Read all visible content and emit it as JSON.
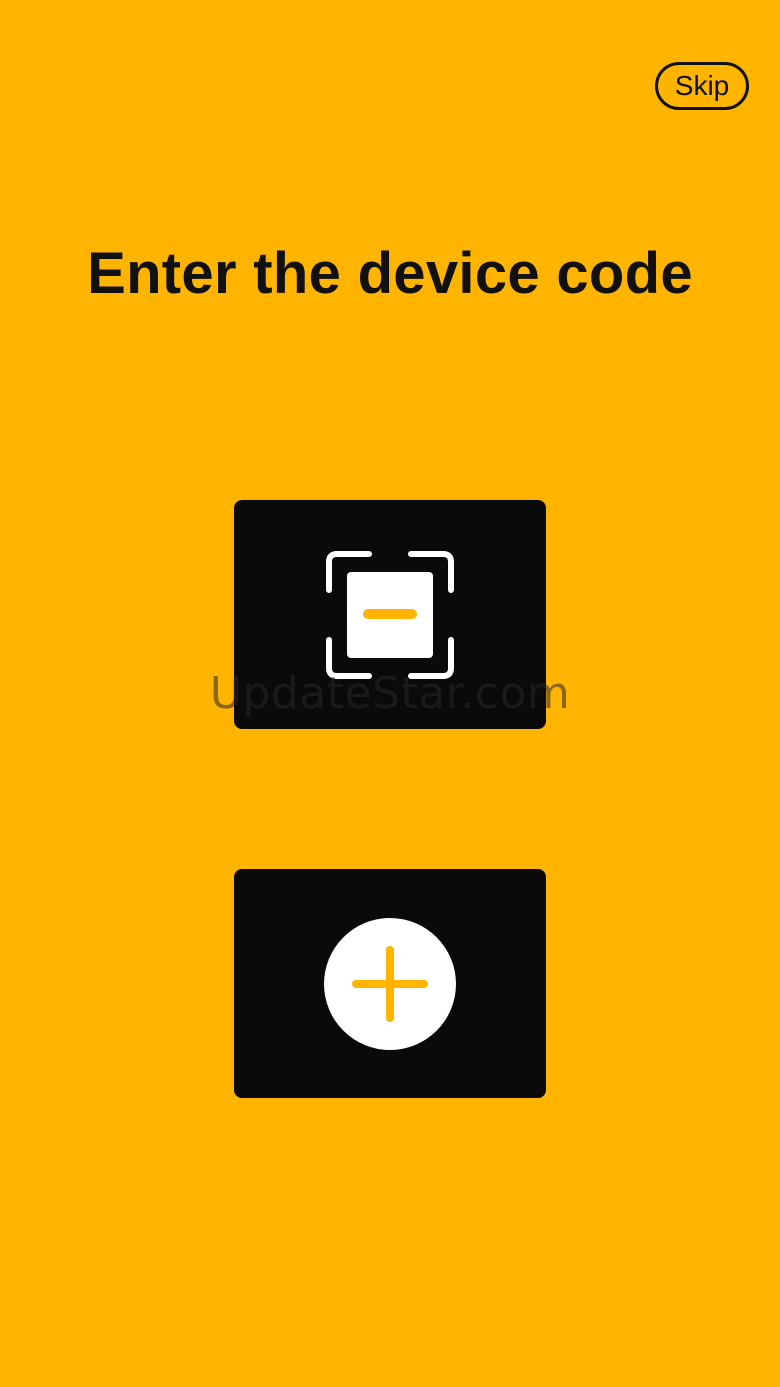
{
  "header": {
    "skip_label": "Skip"
  },
  "main": {
    "title": "Enter the device code",
    "actions": [
      {
        "icon": "scan-frame-icon"
      },
      {
        "icon": "plus-circle-icon"
      }
    ]
  },
  "watermark": "UpdateStar.com",
  "colors": {
    "background": "#FFB400",
    "card": "#0A0A0A",
    "icon_light": "#FFFFFF",
    "accent": "#FFB400",
    "text": "#111111"
  }
}
